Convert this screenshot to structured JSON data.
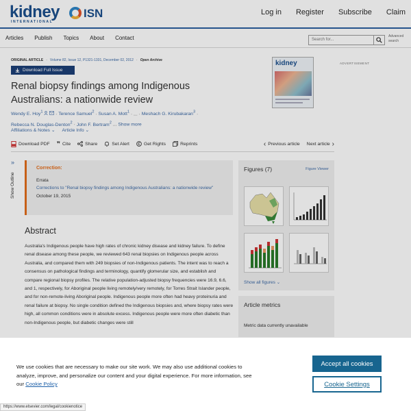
{
  "header": {
    "logo_text": "kidney",
    "logo_sub": "INTERNATIONAL",
    "isn_text": "ISN",
    "links": [
      "Log in",
      "Register",
      "Subscribe",
      "Claim"
    ]
  },
  "nav": {
    "items": [
      "Articles",
      "Publish",
      "Topics",
      "About",
      "Contact"
    ],
    "search_placeholder": "Search for...",
    "advanced_search": "Advanced search"
  },
  "article": {
    "type": "ORIGINAL ARTICLE",
    "volume": "Volume 82, Issue 12, P1321-1331, December 02, 2012",
    "access": "Open Archive",
    "download_label": "Download Full Issue",
    "title": "Renal biopsy findings among Indigenous Australians: a nationwide review",
    "authors": [
      {
        "name": "Wendy E. Hoy",
        "sup": "1"
      },
      {
        "name": "Terence Samuel",
        "sup": "2"
      },
      {
        "name": "Susan A. Mott",
        "sup": "1"
      },
      {
        "name": "Meshach G. Kirubakaran",
        "sup": "3"
      },
      {
        "name": "Rebecca N. Douglas-Denton",
        "sup": "2"
      },
      {
        "name": "John F. Bertram",
        "sup": "2"
      }
    ],
    "ellipsis": "...",
    "show_more": "Show more",
    "affiliations": "Affiliations & Notes",
    "article_info": "Article Info",
    "actions": [
      "Download PDF",
      "Cite",
      "Share",
      "Set Alert",
      "Get Rights",
      "Reprints"
    ],
    "prev": "Previous article",
    "next": "Next article",
    "advertisement": "ADVERTISEMENT",
    "cover_title": "kidney"
  },
  "outline": {
    "label": "Show Outline"
  },
  "correction": {
    "label": "Correction:",
    "type": "Errata",
    "link": "Corrections to \"Renal biopsy findings among Indigenous Australians: a nationwide review\"",
    "date": "October 19, 2015"
  },
  "abstract": {
    "heading": "Abstract",
    "text": "Australia's Indigenous people have high rates of chronic kidney disease and kidney failure. To define renal disease among these people, we reviewed 643 renal biopsies on Indigenous people across Australia, and compared them with 249 biopsies of non-Indigenous patients. The intent was to reach a consensus on pathological findings and terminology, quantify glomerular size, and establish and compare regional biopsy profiles. The relative population-adjusted biopsy frequencies were 16.9, 6.6, and 1, respectively, for Aboriginal people living remotely/very remotely, for Torres Strait Islander people, and for non-remote-living Aboriginal people. Indigenous people more often had heavy proteinuria and renal failure at biopsy. No single condition defined the Indigenous biopsies and, where biopsy rates were high, all common conditions were in absolute excess. Indigenous people were more often diabetic than non-Indigenous people, but diabetic changes were still"
  },
  "figures": {
    "heading": "Figures (7)",
    "viewer": "Figure Viewer",
    "show_all": "Show all figures"
  },
  "metrics": {
    "heading": "Article metrics",
    "text": "Metric data currently unavailable"
  },
  "cookie": {
    "text": "We use cookies that are necessary to make our site work. We may also use additional cookies to analyze, improve, and personalize our content and your digital experience. For more information, see our",
    "policy_link": "Cookie Policy",
    "accept": "Accept all cookies",
    "settings": "Cookie Settings"
  },
  "status_url": "https://www.elsevier.com/legal/cookienotice",
  "colors": {
    "brand_blue": "#1b4f8c",
    "link_blue": "#3d6aa6",
    "correction_orange": "#e36d1b",
    "cookie_button": "#17658f"
  }
}
